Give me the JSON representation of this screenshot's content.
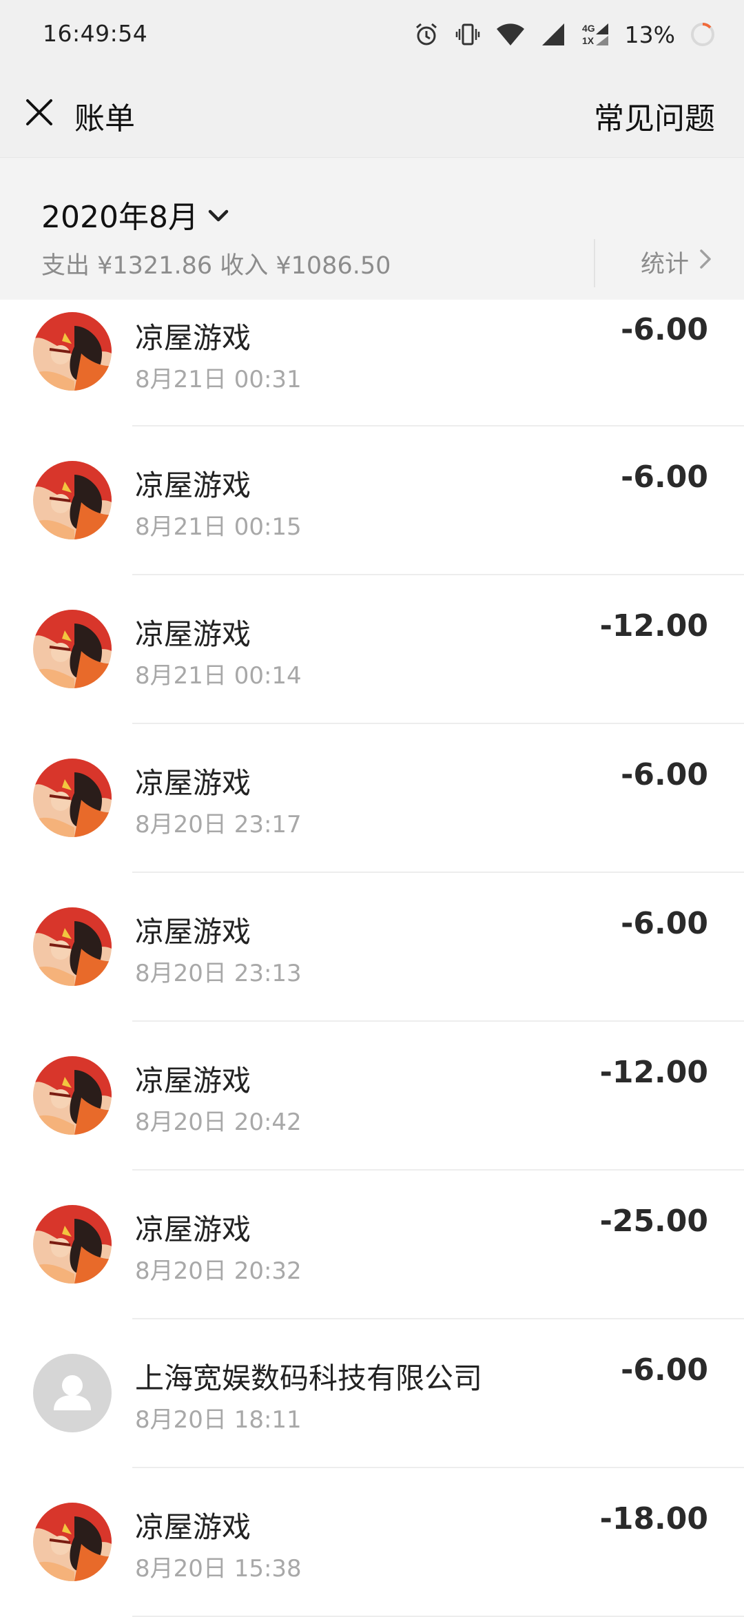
{
  "status_bar": {
    "time": "16:49:54",
    "network": "4G 1X",
    "battery": "13%"
  },
  "nav": {
    "title": "账单",
    "faq_label": "常见问题"
  },
  "summary": {
    "month": "2020年8月",
    "totals": "支出 ¥1321.86 收入 ¥1086.50",
    "stats_label": "统计"
  },
  "colors": {
    "avatar_red": "#d8362b",
    "avatar_default": "#d6d6d6"
  },
  "transactions": [
    {
      "name": "凉屋游戏",
      "date": "8月21日 00:31",
      "amount": "-6.00",
      "avatar": "game-avatar"
    },
    {
      "name": "凉屋游戏",
      "date": "8月21日 00:15",
      "amount": "-6.00",
      "avatar": "game-avatar"
    },
    {
      "name": "凉屋游戏",
      "date": "8月21日 00:14",
      "amount": "-12.00",
      "avatar": "game-avatar"
    },
    {
      "name": "凉屋游戏",
      "date": "8月20日 23:17",
      "amount": "-6.00",
      "avatar": "game-avatar"
    },
    {
      "name": "凉屋游戏",
      "date": "8月20日 23:13",
      "amount": "-6.00",
      "avatar": "game-avatar"
    },
    {
      "name": "凉屋游戏",
      "date": "8月20日 20:42",
      "amount": "-12.00",
      "avatar": "game-avatar"
    },
    {
      "name": "凉屋游戏",
      "date": "8月20日 20:32",
      "amount": "-25.00",
      "avatar": "game-avatar"
    },
    {
      "name": "上海宽娱数码科技有限公司",
      "date": "8月20日 18:11",
      "amount": "-6.00",
      "avatar": "default-user-avatar"
    },
    {
      "name": "凉屋游戏",
      "date": "8月20日 15:38",
      "amount": "-18.00",
      "avatar": "game-avatar"
    }
  ]
}
